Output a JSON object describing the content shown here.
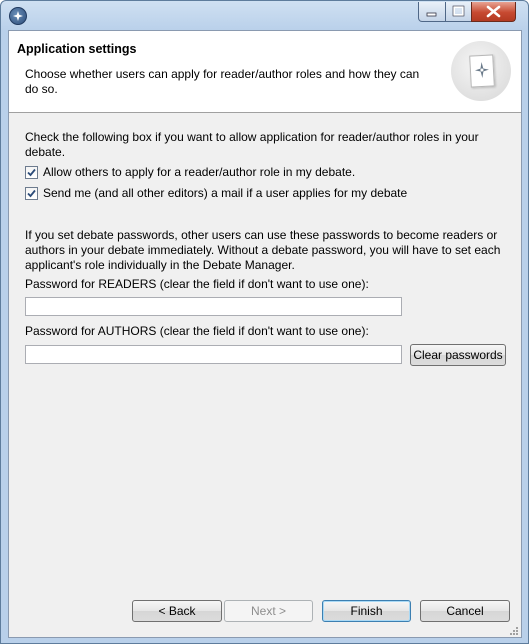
{
  "window": {
    "title": ""
  },
  "banner": {
    "title": "Application settings",
    "description": "Choose whether users can apply for reader/author roles and how they can do so."
  },
  "intro": "Check the following box if you want to allow application for reader/author roles in your debate.",
  "checkboxes": [
    {
      "label": "Allow others to apply for a reader/author role in my debate.",
      "checked": true
    },
    {
      "label": "Send me (and all other editors) a mail if a user applies for my debate",
      "checked": true
    }
  ],
  "password_info": "If you set debate passwords, other users can use these passwords to become readers or authors in your debate immediately. Without a debate password, you will have to set each applicant's role individually in the Debate Manager.",
  "readers": {
    "label": "Password for READERS (clear the field if don't want to use one):",
    "value": ""
  },
  "authors": {
    "label": "Password for AUTHORS (clear the field if don't want to use one):",
    "value": ""
  },
  "buttons": {
    "clear": "Clear passwords",
    "back": "< Back",
    "next": "Next >",
    "finish": "Finish",
    "cancel": "Cancel"
  }
}
